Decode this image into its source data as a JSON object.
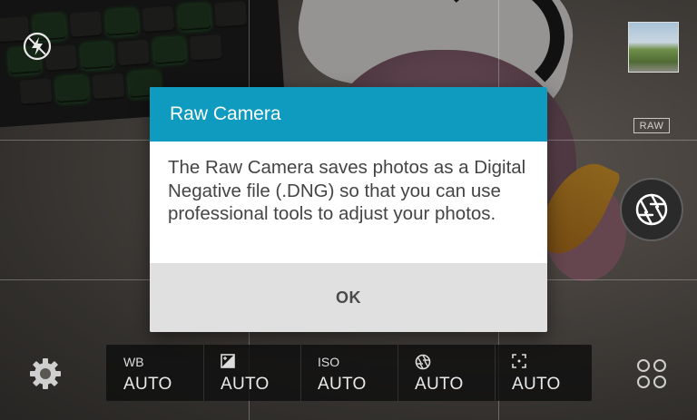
{
  "dialog": {
    "title": "Raw Camera",
    "message": "The Raw Camera saves photos as a Digital Negative file (.DNG) so that you can use professional tools to adjust your photos.",
    "ok_label": "OK"
  },
  "camera": {
    "raw_badge": "RAW",
    "flash_icon": "flash-auto-icon",
    "shutter_icon": "aperture-icon",
    "settings_icon": "gear-icon",
    "modes_icon": "modes-grid-icon"
  },
  "settings_bar": {
    "items": [
      {
        "label": "WB",
        "icon": null,
        "value": "AUTO"
      },
      {
        "label": "",
        "icon": "exposure-icon",
        "value": "AUTO"
      },
      {
        "label": "ISO",
        "icon": null,
        "value": "AUTO"
      },
      {
        "label": "",
        "icon": "shutter-speed-icon",
        "value": "AUTO"
      },
      {
        "label": "",
        "icon": "focus-icon",
        "value": "AUTO"
      }
    ]
  },
  "colors": {
    "dialog_header": "#0e9bbf",
    "dialog_footer": "#e0e0e0"
  }
}
